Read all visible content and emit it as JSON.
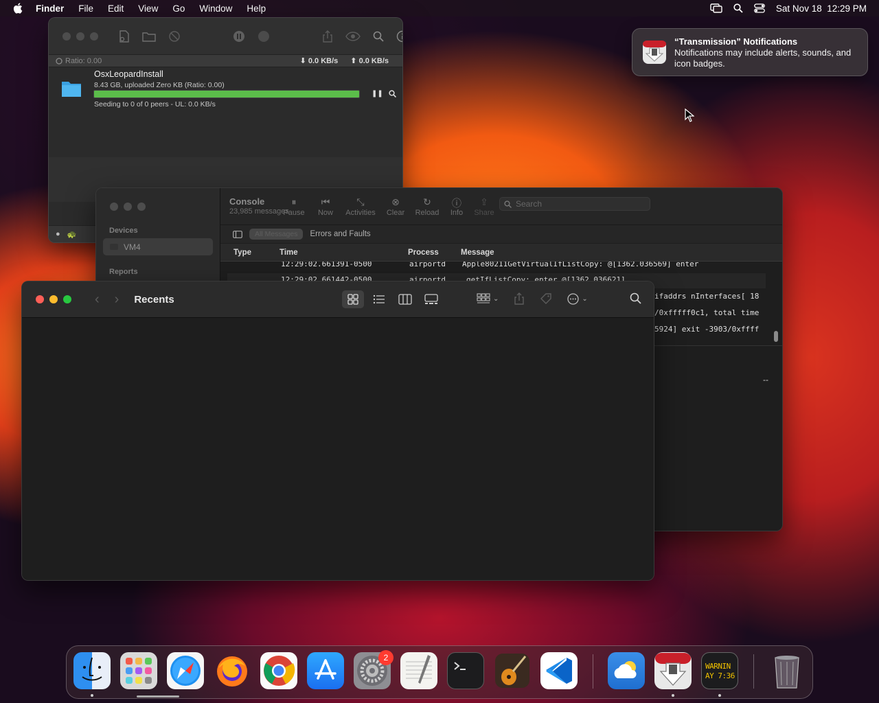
{
  "menubar": {
    "app_name": "Finder",
    "items": [
      "File",
      "Edit",
      "View",
      "Go",
      "Window",
      "Help"
    ],
    "clock": "Sat Nov 18  12:29 PM"
  },
  "notification": {
    "title": "“Transmission” Notifications",
    "body": "Notifications may include alerts, sounds, and icon badges."
  },
  "transmission": {
    "ratio": "Ratio: 0.00",
    "down_speed": "0.0 KB/s",
    "up_speed": "0.0 KB/s",
    "torrent": {
      "name": "OsxLeopardInstall",
      "info": "8.43 GB, uploaded Zero KB (Ratio: 0.00)",
      "progress": 1.0,
      "status": "Seeding to 0 of 0 peers - UL: 0.0 KB/s"
    }
  },
  "console": {
    "title": "Console",
    "message_count": "23,985 messages",
    "sidebar": {
      "devices_header": "Devices",
      "device": "VM4",
      "reports_header": "Reports"
    },
    "toolbar": [
      "Pause",
      "Now",
      "Activities",
      "Clear",
      "Reload",
      "Info",
      "Share"
    ],
    "search_placeholder": "Search",
    "filters": {
      "all": "All Messages",
      "errors": "Errors and Faults"
    },
    "columns": [
      "Type",
      "Time",
      "Process",
      "Message"
    ],
    "rows": [
      {
        "time": "12:29:02.661391-0500",
        "process": "airportd",
        "message": "Apple80211GetVirtualIfListCopy: @[1362.036569] enter"
      },
      {
        "time": "12:29:02.661442-0500",
        "process": "airportd",
        "message": "getIfListCopy: enter @[1362.036621]"
      }
    ],
    "row_tails": [
      "ifaddrs nInterfaces[ 18",
      "/0xfffff0c1, total time",
      "5924] exit -3903/0xffff"
    ],
    "detail_dash": "--"
  },
  "finder": {
    "title": "Recents"
  },
  "dock": {
    "apps": [
      "Finder",
      "Launchpad",
      "Safari",
      "Firefox",
      "Chrome",
      "App Store",
      "System Settings",
      "TextEdit",
      "Terminal",
      "GarageBand",
      "Visual Studio Code",
      "Weather",
      "Transmission",
      "Console"
    ],
    "system_settings_badge": "2",
    "console_icon_text": [
      "WARNIN",
      "AY 7:36"
    ],
    "trash": "Trash"
  },
  "colors": {
    "progress_green": "#5bbd4a",
    "close_red": "#ff5f57",
    "minimize_yellow": "#febc2e",
    "zoom_green": "#28c840",
    "badge_red": "#ff3b30"
  }
}
